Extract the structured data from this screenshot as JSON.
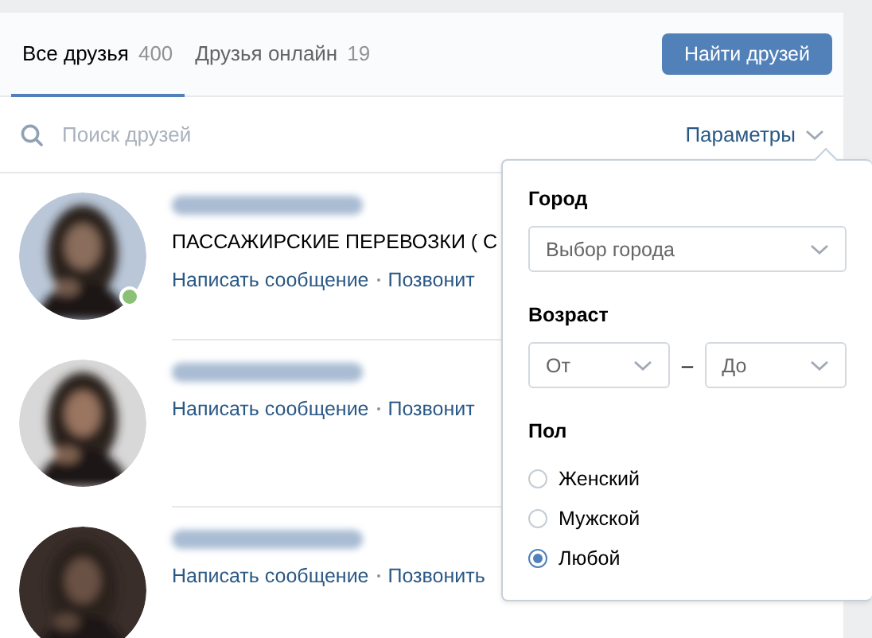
{
  "tabs": [
    {
      "label": "Все друзья",
      "count": "400",
      "selected": true
    },
    {
      "label": "Друзья онлайн",
      "count": "19",
      "selected": false
    }
  ],
  "find_button": "Найти друзей",
  "search": {
    "placeholder": "Поиск друзей"
  },
  "params_toggle": {
    "label": "Параметры",
    "expanded": true
  },
  "friends": [
    {
      "online": true,
      "status": "ПАССАЖИРСКИЕ ПЕРЕВОЗКИ ( С",
      "actions": [
        "Написать сообщение",
        "Позвонит"
      ]
    },
    {
      "online": false,
      "actions": [
        "Написать сообщение",
        "Позвонит"
      ]
    },
    {
      "online": false,
      "actions": [
        "Написать сообщение",
        "Позвонить"
      ]
    }
  ],
  "filters": {
    "city_label": "Город",
    "city": {
      "placeholder": "Выбор города"
    },
    "age_label": "Возраст",
    "age_from": {
      "placeholder": "От"
    },
    "age_separator": "–",
    "age_to": {
      "placeholder": "До"
    },
    "sex_label": "Пол",
    "sex_options": [
      {
        "label": "Женский",
        "selected": false
      },
      {
        "label": "Мужской",
        "selected": false
      },
      {
        "label": "Любой",
        "selected": true
      }
    ]
  }
}
